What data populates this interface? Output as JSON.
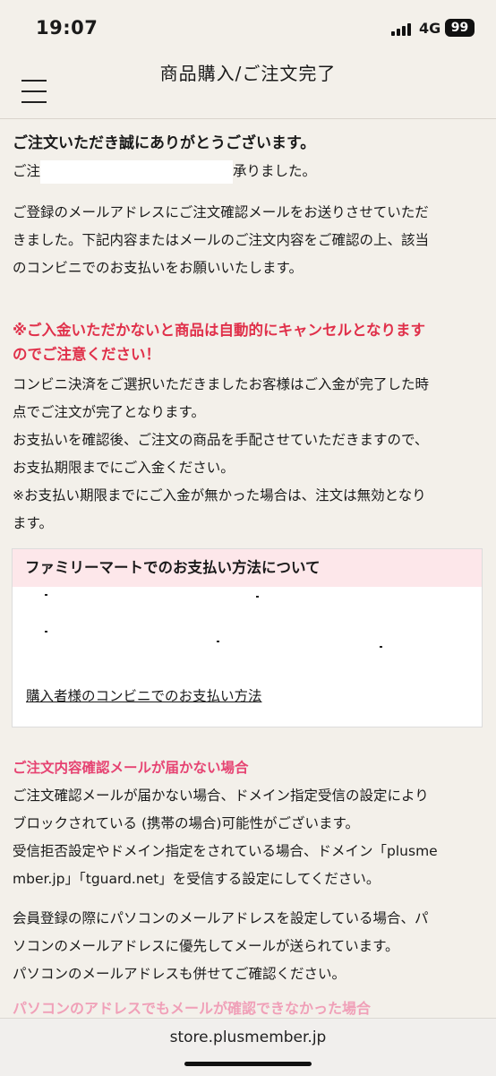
{
  "status_bar": {
    "time": "19:07",
    "network": "4G",
    "battery": "99"
  },
  "header": {
    "title": "商品購入/ご注文完了"
  },
  "thanks": {
    "title": "ご注文いただき誠にありがとうございます。",
    "line_start": "ご注",
    "line_end": "承りました。"
  },
  "intro": {
    "lines": [
      "ご登録のメールアドレスにご注文確認メールをお送りさせていただ",
      "きました。下記内容またはメールのご注文内容をご確認の上、該当",
      "のコンビニでのお支払いをお願いいたします。"
    ]
  },
  "warning": {
    "lines": [
      "※ご入金いただかないと商品は自動的にキャンセルとなります",
      "のでご注意ください！"
    ]
  },
  "notice": {
    "lines": [
      "コンビニ決済をご選択いただきましたお客様はご入金が完了した時",
      "点でご注文が完了となります。",
      "お支払いを確認後、ご注文の商品を手配させていただきますので、",
      "お支払期限までにご入金ください。",
      "※お支払い期限までにご入金が無かった場合は、注文は無効となり",
      "ます。"
    ]
  },
  "payment_box": {
    "title": "ファミリーマートでのお支払い方法について",
    "link": "購入者様のコンビニでのお支払い方法"
  },
  "mail_not_received": {
    "heading": "ご注文内容確認メールが届かない場合",
    "lines": [
      "ご注文確認メールが届かない場合、ドメイン指定受信の設定により",
      "ブロックされている (携帯の場合)可能性がございます。",
      "受信拒否設定やドメイン指定をされている場合、ドメイン「plusme",
      "mber.jp」「tguard.net」を受信する設定にしてください。"
    ],
    "lines2": [
      "会員登録の際にパソコンのメールアドレスを設定している場合、パ",
      "ソコンのメールアドレスに優先してメールが送られています。",
      "パソコンのメールアドレスも併せてご確認ください。"
    ]
  },
  "partial_heading": "パソコンのアドレスでもメールが確認できなかった場合",
  "browser": {
    "url": "store.plusmember.jp"
  },
  "icons": {
    "menu": "hamburger-menu-icon",
    "signal": "cellular-signal-icon",
    "battery": "battery-icon"
  },
  "colors": {
    "warning": "#e0304a",
    "heading_pink": "#e64372",
    "box_header_bg": "#fde7ea",
    "page_bg": "#f3f0ea"
  }
}
